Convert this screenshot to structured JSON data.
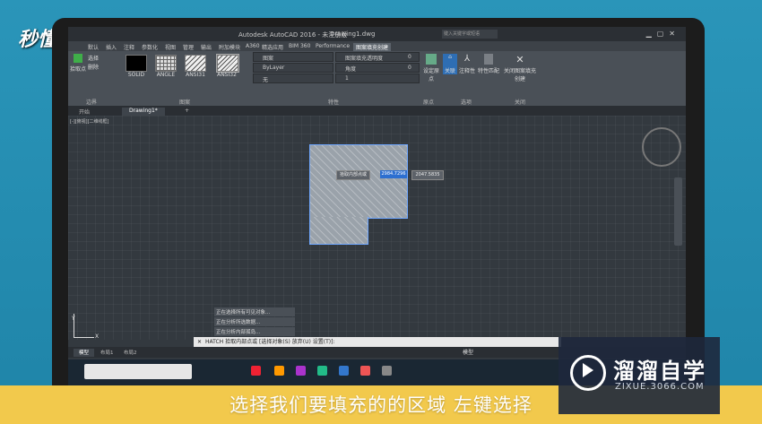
{
  "overlay": {
    "brand_logo": "秒懂视频",
    "caption": "选择我们要填充的的区域 左键选择",
    "watermark_title": "溜溜自学",
    "watermark_url": "ZIXUE.3066.COM"
  },
  "window": {
    "title": "Autodesk AutoCAD 2016 - 未注册版",
    "document": "Drawing1.dwg",
    "search_placeholder": "键入关键字或短语"
  },
  "ribbon": {
    "tabs": [
      "默认",
      "插入",
      "注释",
      "参数化",
      "视图",
      "管理",
      "输出",
      "附加模块",
      "A360",
      "精选应用",
      "BIM 360",
      "Performance",
      "图案填充创建"
    ],
    "active_tab": "图案填充创建",
    "boundary": {
      "pick_label": "拾取点",
      "select_label": "选择",
      "remove_label": "删除",
      "panel": "边界"
    },
    "patterns": [
      "SOLID",
      "ANGLE",
      "ANSI31",
      "ANSI32"
    ],
    "pattern_panel": "图案",
    "props": {
      "type": "图案",
      "color": "ByLayer",
      "bg": "无",
      "transparency_label": "图案填充透明度",
      "transparency": "0",
      "angle_label": "角度",
      "angle": "0",
      "scale": "1",
      "panel": "特性"
    },
    "origin": {
      "label": "设定原点",
      "panel": "原点"
    },
    "options": {
      "assoc": "关联",
      "annot": "注释性",
      "match": "特性匹配",
      "panel": "选项"
    },
    "close": {
      "label": "关闭图案填充创建",
      "panel": "关闭"
    }
  },
  "doc_tabs": [
    "开始",
    "Drawing1*"
  ],
  "viewport_label": "[-][俯视][二维线框]",
  "canvas": {
    "tooltip": "拾取内部点或",
    "coord_x": "2984.7296",
    "coord_y": "2047.5835"
  },
  "command": {
    "history": [
      "正在选择所有可见对象...",
      "正在分析所选数据...",
      "正在分析内部孤岛..."
    ],
    "prompt": "HATCH 拾取内部点或 [选择对象(S) 放弃(U) 设置(T)]:"
  },
  "layout_tabs": [
    "模型",
    "布局1",
    "布局2"
  ],
  "status": {
    "model": "模型"
  },
  "ucs": {
    "x": "X",
    "y": "Y"
  },
  "colors": {
    "accent": "#2d6fd0",
    "caption_bar": "#f2c94c",
    "background": "#2d8fb3"
  }
}
